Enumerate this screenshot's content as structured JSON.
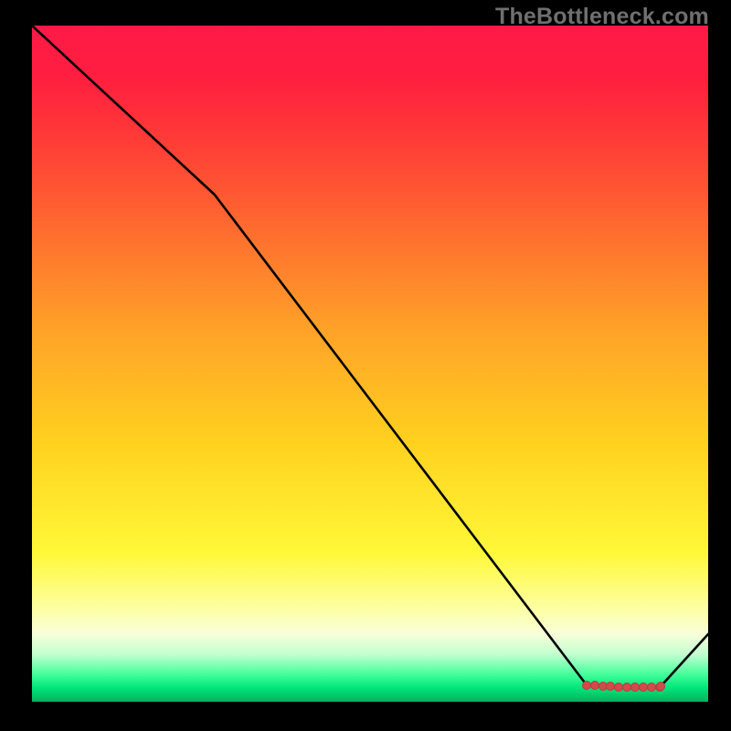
{
  "watermark": "TheBottleneck.com",
  "chart_data": {
    "type": "line",
    "title": "",
    "xlabel": "",
    "ylabel": "",
    "xlim": [
      0,
      100
    ],
    "ylim": [
      0,
      100
    ],
    "grid": false,
    "line_color": "#000000",
    "marker_color": "#d24a4a",
    "series": [
      {
        "name": "curve",
        "x": [
          0,
          27,
          82,
          84.5,
          87,
          89.5,
          91.5,
          93,
          100
        ],
        "y": [
          100,
          75,
          2.5,
          2.2,
          2.1,
          2.0,
          2.1,
          2.3,
          10
        ]
      }
    ],
    "markers": {
      "series": "curve",
      "x": [
        82,
        83.2,
        84.4,
        85.6,
        86.8,
        88,
        89.2,
        90.4,
        91.6,
        92.8,
        93
      ],
      "y": [
        2.5,
        2.4,
        2.3,
        2.25,
        2.2,
        2.15,
        2.1,
        2.1,
        2.15,
        2.2,
        2.3
      ]
    }
  }
}
